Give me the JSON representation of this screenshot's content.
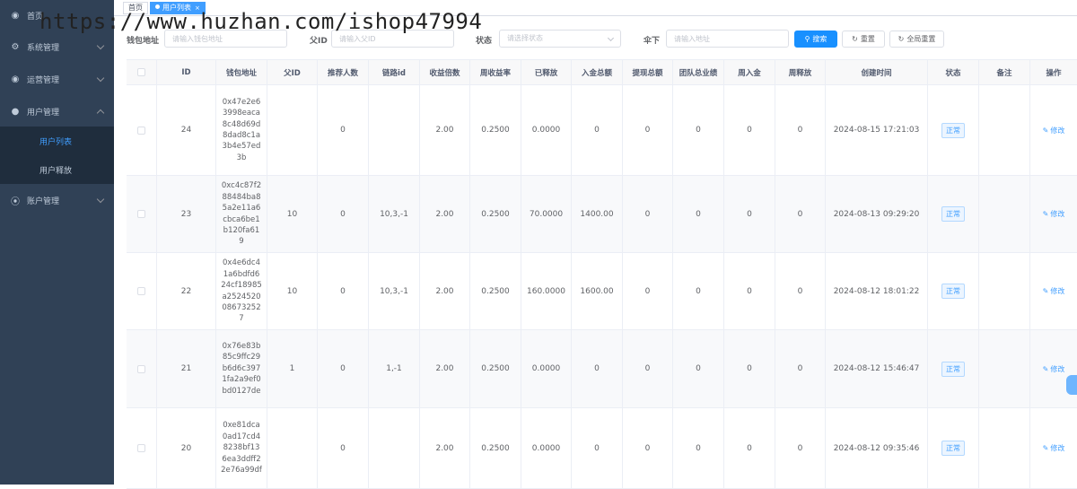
{
  "watermark": "https://www.huzhan.com/ishop47994",
  "sidebar": {
    "items": [
      {
        "label": "首页",
        "icon": "dashboard-icon"
      },
      {
        "label": "系统管理",
        "icon": "gear-icon"
      },
      {
        "label": "运营管理",
        "icon": "dashboard-icon"
      },
      {
        "label": "用户管理",
        "icon": "user-icon"
      },
      {
        "label": "账户管理",
        "icon": "circle-icon"
      }
    ],
    "sub_items": [
      {
        "label": "用户列表",
        "active": true
      },
      {
        "label": "用户释放",
        "active": false
      }
    ]
  },
  "tags": {
    "home": "首页",
    "active": "用户列表",
    "close": "×"
  },
  "filters": {
    "wallet_label": "钱包地址",
    "wallet_placeholder": "请输入钱包地址",
    "parent_label": "父ID",
    "parent_placeholder": "请输入父ID",
    "status_label": "状态",
    "status_placeholder": "请选择状态",
    "under_label": "伞下",
    "under_placeholder": "请输入地址",
    "search_btn": "搜索",
    "reset_btn": "重置",
    "global_reset_btn": "全局重置"
  },
  "table": {
    "headers": [
      "ID",
      "钱包地址",
      "父ID",
      "推荐人数",
      "链路id",
      "收益倍数",
      "周收益率",
      "已释放",
      "入金总额",
      "提现总额",
      "团队总业绩",
      "周入金",
      "周释放",
      "创建时间",
      "状态",
      "备注",
      "操作"
    ],
    "edit_label": "修改",
    "rows": [
      {
        "id": "24",
        "addr": "0x47e2e63998eaca8c48d69d8dad8c1a3b4e57ed3b",
        "pid": "",
        "refs": "0",
        "path": "",
        "mult": "2.00",
        "rate": "0.2500",
        "released": "0.0000",
        "deposit": "0",
        "withdraw": "0",
        "team": "0",
        "wdeposit": "0",
        "wrelease": "0",
        "created": "2024-08-15 17:21:03",
        "status": "正常",
        "note": ""
      },
      {
        "id": "23",
        "addr": "0xc4c87f288484ba85a2e11a6cbca6be1b120fa619",
        "pid": "10",
        "refs": "0",
        "path": "10,3,-1",
        "mult": "2.00",
        "rate": "0.2500",
        "released": "70.0000",
        "deposit": "1400.00",
        "withdraw": "0",
        "team": "0",
        "wdeposit": "0",
        "wrelease": "0",
        "created": "2024-08-13 09:29:20",
        "status": "正常",
        "note": ""
      },
      {
        "id": "22",
        "addr": "0x4e6dc41a6bdfd624cf18985a2524520086732527",
        "pid": "10",
        "refs": "0",
        "path": "10,3,-1",
        "mult": "2.00",
        "rate": "0.2500",
        "released": "160.0000",
        "deposit": "1600.00",
        "withdraw": "0",
        "team": "0",
        "wdeposit": "0",
        "wrelease": "0",
        "created": "2024-08-12 18:01:22",
        "status": "正常",
        "note": ""
      },
      {
        "id": "21",
        "addr": "0x76e83b85c9ffc29b6d6c3971fa2a9ef0bd0127de",
        "pid": "1",
        "refs": "0",
        "path": "1,-1",
        "mult": "2.00",
        "rate": "0.2500",
        "released": "0.0000",
        "deposit": "0",
        "withdraw": "0",
        "team": "0",
        "wdeposit": "0",
        "wrelease": "0",
        "created": "2024-08-12 15:46:47",
        "status": "正常",
        "note": ""
      },
      {
        "id": "20",
        "addr": "0xe81dca0ad17cd48238bf136ea3ddff22e76a99df",
        "pid": "",
        "refs": "0",
        "path": "",
        "mult": "2.00",
        "rate": "0.2500",
        "released": "0.0000",
        "deposit": "0",
        "withdraw": "0",
        "team": "0",
        "wdeposit": "0",
        "wrelease": "0",
        "created": "2024-08-12 09:35:46",
        "status": "正常",
        "note": ""
      }
    ]
  }
}
